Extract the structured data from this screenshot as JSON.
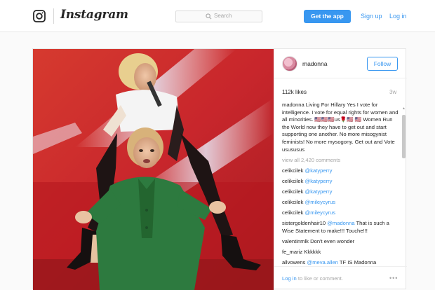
{
  "header": {
    "brand": "Instagram",
    "search_placeholder": "Search",
    "get_app_label": "Get the app",
    "signup_label": "Sign up",
    "login_label": "Log in"
  },
  "post": {
    "username": "madonna",
    "follow_label": "Follow",
    "likes": "112k likes",
    "age": "3w",
    "caption_user": "madonna",
    "caption_text": "Living For Hillary Yes I vote for intelligence. I vote for equal rights for women and all minorities. 🇺🇸🇺🇸🇺🇸us🌹🇺🇸 🇺🇸 Women Run the World now they have to get out and start supporting one another. No more misogynist feminists! No more mysogony. Get out and Vote usususus",
    "view_all": "view all 2,420 comments",
    "comments": [
      {
        "user": "celikcilek",
        "mention": "@katyperry",
        "text": ""
      },
      {
        "user": "celikcilek",
        "mention": "@katyperry",
        "text": ""
      },
      {
        "user": "celikcilek",
        "mention": "@katyperry",
        "text": ""
      },
      {
        "user": "celikcilek",
        "mention": "@mileycyrus",
        "text": ""
      },
      {
        "user": "celikcilek",
        "mention": "@mileycyrus",
        "text": ""
      },
      {
        "user": "sistergoldenhair10",
        "mention": "@madonna",
        "text": "That is such a Wise Statement to make!!! Touche!!!"
      },
      {
        "user": "valentinmlk",
        "mention": "",
        "text": "Don't even wonder"
      },
      {
        "user": "fe_mariz",
        "mention": "",
        "text": "Kkkkkk"
      },
      {
        "user": "allvowens",
        "mention": "@meva.allen",
        "text": "TF IS Madonna"
      }
    ],
    "footer_login": "Log in",
    "footer_rest": "to like or comment."
  },
  "colors": {
    "accent": "#3897f0",
    "bg": "#fafafa",
    "stage_red": "#c8262c"
  },
  "icons": {
    "logo": "instagram-camera-icon",
    "search": "search-icon",
    "more": "more-options-icon"
  }
}
